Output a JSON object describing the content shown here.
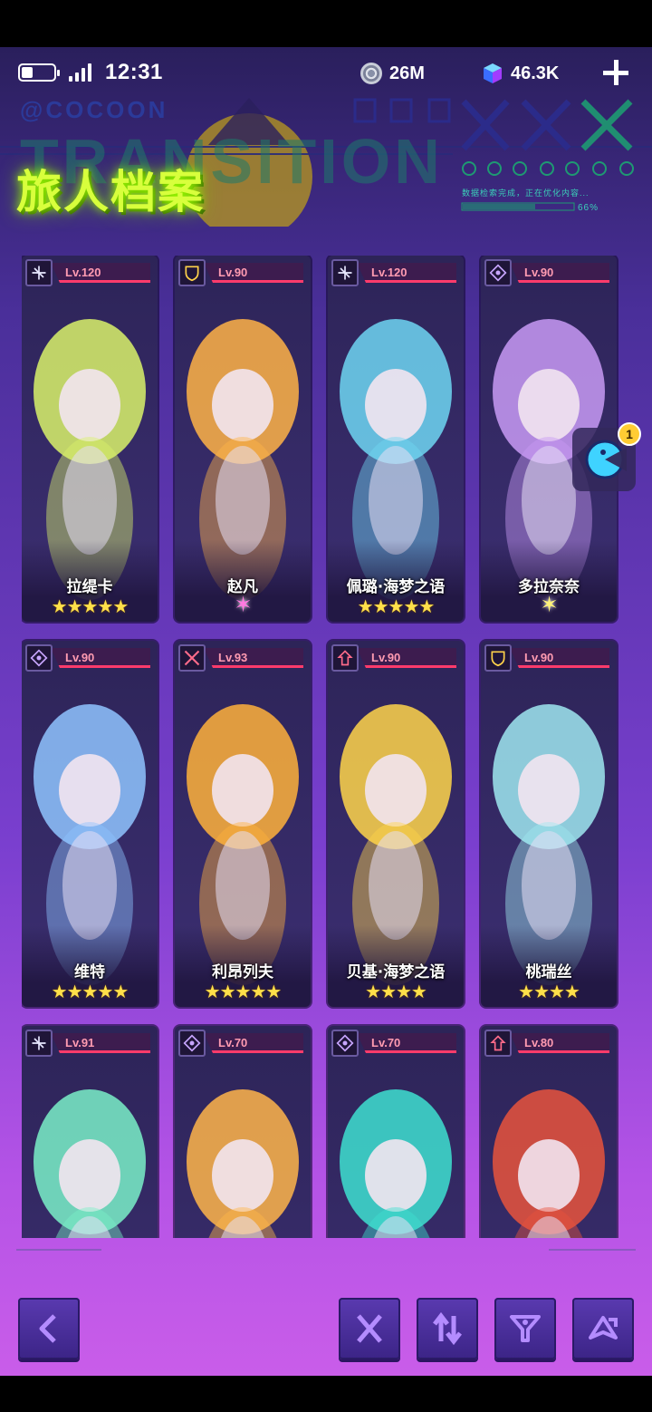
{
  "status_bar": {
    "time": "12:31",
    "coin_amount": "26M",
    "gem_amount": "46.3K"
  },
  "header": {
    "title": "旅人档案",
    "deco_brand": "@COCOON",
    "deco_word": "TRANSITION",
    "deco_status": "数据检索完成，正在优化内容...",
    "deco_percent": "66%"
  },
  "float_widget": {
    "badge": "1"
  },
  "characters": [
    {
      "name": "拉缇卡",
      "level": "Lv.120",
      "stars": "★★★★★",
      "star_style": "gold-row",
      "class_icon": "archer-icon",
      "accent": "#d9f26a"
    },
    {
      "name": "赵凡",
      "level": "Lv.90",
      "stars": "✶",
      "star_style": "pink-burst",
      "class_icon": "shield-icon",
      "accent": "#ffb347"
    },
    {
      "name": "佩璐·海梦之语",
      "level": "Lv.120",
      "stars": "★★★★★",
      "star_style": "gold-row",
      "class_icon": "archer-icon",
      "accent": "#6fd6f2"
    },
    {
      "name": "多拉奈奈",
      "level": "Lv.90",
      "stars": "✶",
      "star_style": "gold-burst",
      "class_icon": "mage-icon",
      "accent": "#c89af5"
    },
    {
      "name": "维特",
      "level": "Lv.90",
      "stars": "★★★★★",
      "star_style": "gold-row",
      "class_icon": "mage-icon",
      "accent": "#8fc4ff"
    },
    {
      "name": "利昂列夫",
      "level": "Lv.93",
      "stars": "★★★★★",
      "star_style": "gold-row",
      "class_icon": "swords-icon",
      "accent": "#ffb13b"
    },
    {
      "name": "贝基·海梦之语",
      "level": "Lv.90",
      "stars": "★★★★",
      "star_style": "gold-row",
      "class_icon": "support-icon",
      "accent": "#ffd54a"
    },
    {
      "name": "桃瑞丝",
      "level": "Lv.90",
      "stars": "★★★★",
      "star_style": "gold-row",
      "class_icon": "shield-icon",
      "accent": "#9fe8f0"
    },
    {
      "name": "",
      "level": "Lv.91",
      "stars": "",
      "star_style": "gold-row",
      "class_icon": "archer-icon",
      "accent": "#7af0c8"
    },
    {
      "name": "",
      "level": "Lv.70",
      "stars": "",
      "star_style": "gold-row",
      "class_icon": "mage-icon",
      "accent": "#ffb54a"
    },
    {
      "name": "",
      "level": "Lv.70",
      "stars": "",
      "star_style": "gold-row",
      "class_icon": "mage-icon",
      "accent": "#3ee0d0"
    },
    {
      "name": "",
      "level": "Lv.80",
      "stars": "",
      "star_style": "gold-row",
      "class_icon": "support-icon",
      "accent": "#e8533c"
    }
  ],
  "colors": {
    "title_green": "#d8ff3c",
    "level_red": "#ff3b6b",
    "button_purple": "#4a2f9a"
  }
}
